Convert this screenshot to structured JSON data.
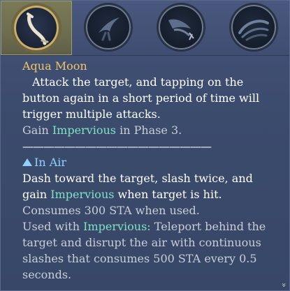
{
  "skills": [
    {
      "icon": "curved-dagger-icon",
      "selected": true
    },
    {
      "icon": "bird-slash-icon",
      "selected": false
    },
    {
      "icon": "dash-strike-icon",
      "selected": false
    },
    {
      "icon": "wave-slash-icon",
      "selected": false
    }
  ],
  "colors": {
    "title": "#f2c46a",
    "keyword": "#7fe3c6",
    "section": "#8fd0ff",
    "muted": "#c9ced8"
  },
  "tooltip": {
    "title": "Aqua Moon",
    "description": "Attack the target, and tapping on the button again in a short period of time will trigger multiple attacks.",
    "phase_prefix": "Gain ",
    "phase_keyword": "Impervious",
    "phase_suffix": " in Phase 3.",
    "divider": "——————————————————",
    "section_title": "In Air",
    "air_desc_prefix": "Dash toward the target, slash twice, and gain ",
    "air_desc_keyword": "Impervious",
    "air_desc_suffix": " when target is hit.",
    "air_cost": "Consumes 300 STA when used.",
    "used_with_prefix": "Used with ",
    "used_with_keyword": "Impervious:",
    "used_with_suffix": " Teleport behind the target and disrupt the air with continuous slashes that consumes 500 STA every 0.5 seconds."
  },
  "scroll_indicator": "»"
}
